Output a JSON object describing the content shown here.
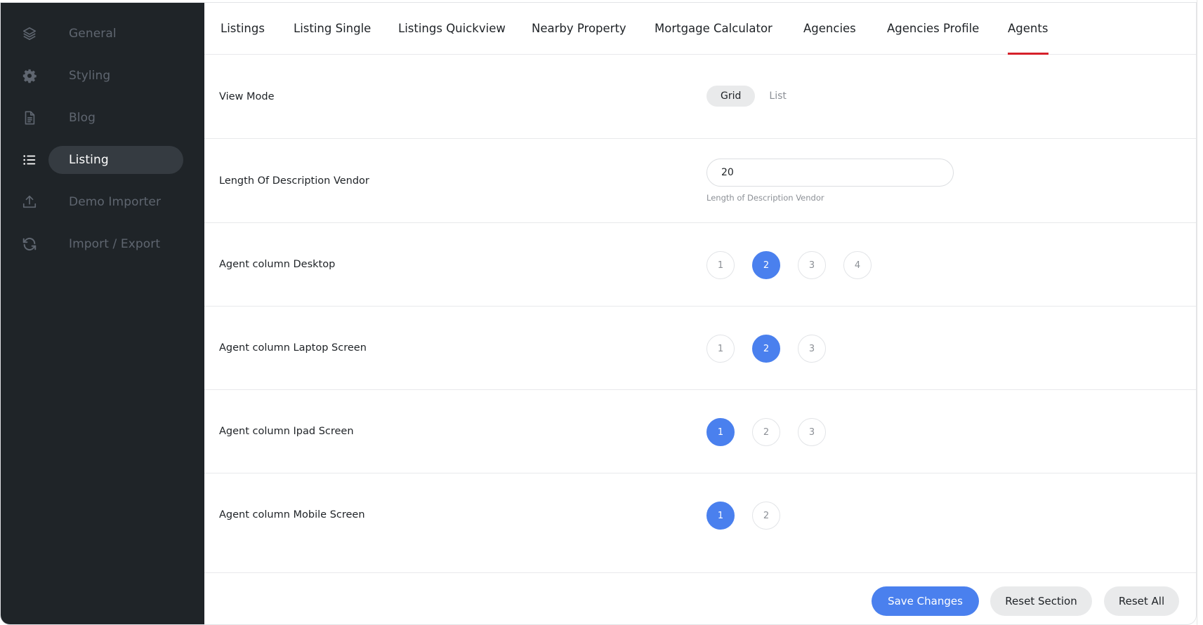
{
  "sidebar": {
    "items": [
      {
        "label": "General",
        "icon": "layers-icon"
      },
      {
        "label": "Styling",
        "icon": "gear-icon"
      },
      {
        "label": "Blog",
        "icon": "document-icon"
      },
      {
        "label": "Listing",
        "icon": "list-icon",
        "active": true
      },
      {
        "label": "Demo Importer",
        "icon": "upload-icon"
      },
      {
        "label": "Import / Export",
        "icon": "sync-icon"
      }
    ]
  },
  "tabs": {
    "items": [
      "Listings",
      "Listing Single",
      "Listings Quickview",
      "Nearby Property",
      "Mortgage Calculator",
      "Agencies",
      "Agencies Profile",
      "Agents"
    ],
    "active": "Agents"
  },
  "fields": {
    "view_mode": {
      "label": "View Mode",
      "options": [
        "Grid",
        "List"
      ],
      "selected": "Grid"
    },
    "desc_length": {
      "label": "Length Of Description Vendor",
      "value": "20",
      "hint": "Length of Description Vendor"
    },
    "col_desktop": {
      "label": "Agent column Desktop",
      "options": [
        "1",
        "2",
        "3",
        "4"
      ],
      "selected": "2"
    },
    "col_laptop": {
      "label": "Agent column Laptop Screen",
      "options": [
        "1",
        "2",
        "3"
      ],
      "selected": "2"
    },
    "col_ipad": {
      "label": "Agent column Ipad Screen",
      "options": [
        "1",
        "2",
        "3"
      ],
      "selected": "1"
    },
    "col_mobile": {
      "label": "Agent column Mobile Screen",
      "options": [
        "1",
        "2"
      ],
      "selected": "1"
    }
  },
  "footer": {
    "save_label": "Save Changes",
    "reset_section_label": "Reset Section",
    "reset_all_label": "Reset All"
  },
  "colors": {
    "sidebar_bg": "#1f2428",
    "accent_blue": "#4a80ee",
    "tab_underline": "#d6202a"
  }
}
